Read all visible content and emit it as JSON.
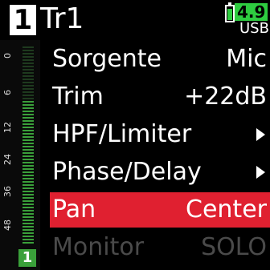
{
  "header": {
    "track_number": "1",
    "track_name": "Tr1",
    "battery": {
      "voltage": "4.9",
      "source": "USB",
      "level": 0.9,
      "color": "#2ecc40"
    }
  },
  "meter": {
    "scale_labels": [
      "0",
      "6",
      "12",
      "24",
      "36",
      "48"
    ],
    "channel_badge": "1",
    "level": 0.72,
    "colors": {
      "active": "#3aa03a",
      "inactive": "#1e3a1e",
      "badge": "#3aa03a"
    }
  },
  "menu": {
    "items": [
      {
        "label": "Sorgente",
        "value": "Mic",
        "arrow": false,
        "state": "normal"
      },
      {
        "label": "Trim",
        "value": "+22dB",
        "arrow": false,
        "state": "normal"
      },
      {
        "label": "HPF/Limiter",
        "value": "",
        "arrow": true,
        "state": "normal"
      },
      {
        "label": "Phase/Delay",
        "value": "",
        "arrow": true,
        "state": "normal"
      },
      {
        "label": "Pan",
        "value": "Center",
        "arrow": false,
        "state": "selected"
      },
      {
        "label": "Monitor",
        "value": "SOLO",
        "arrow": false,
        "state": "disabled"
      }
    ],
    "selected_color": "#e02030"
  }
}
